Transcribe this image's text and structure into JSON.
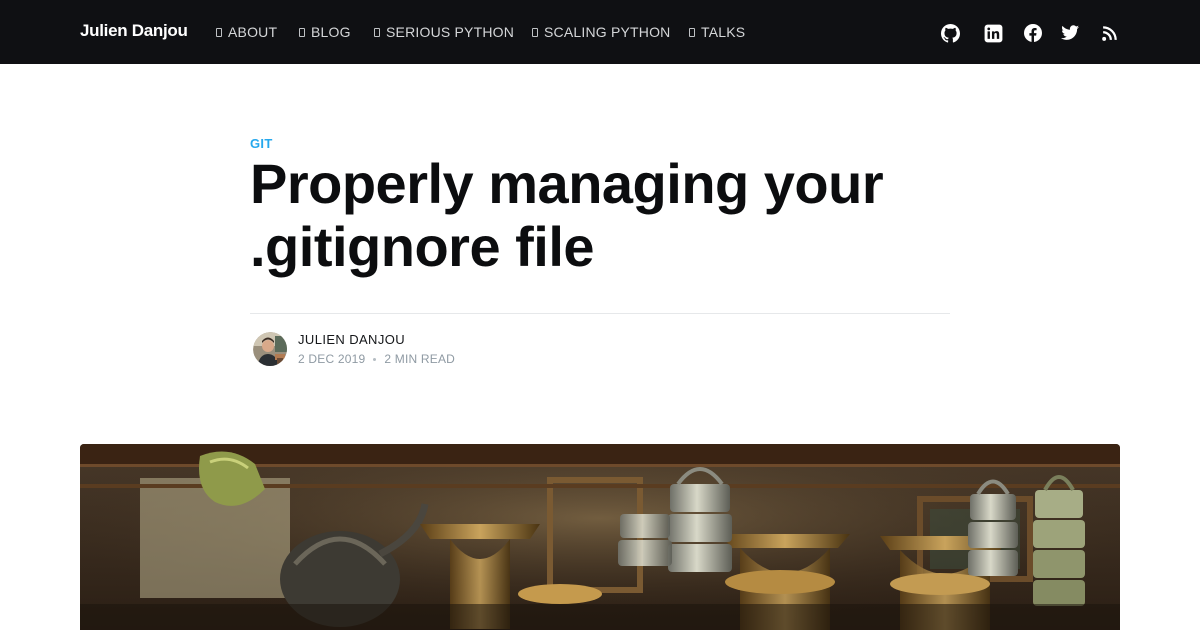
{
  "site": {
    "brand": "Julien Danjou"
  },
  "nav": {
    "items": [
      {
        "label": "ABOUT",
        "icon": "about-icon"
      },
      {
        "label": "BLOG",
        "icon": "blog-icon"
      },
      {
        "label": "SERIOUS PYTHON",
        "icon": "book-icon"
      },
      {
        "label": "SCALING PYTHON",
        "icon": "book-icon"
      },
      {
        "label": "TALKS",
        "icon": "talks-icon"
      }
    ],
    "social": [
      "github-icon",
      "linkedin-icon",
      "facebook-icon",
      "twitter-icon",
      "rss-icon"
    ]
  },
  "post": {
    "tag": "GIT",
    "title": "Properly managing your .gitignore file",
    "author": "JULIEN DANJOU",
    "date": "2 DEC 2019",
    "read_time": "2 MIN READ"
  },
  "colors": {
    "nav_bg": "#0f1013",
    "accent": "#26a8ed",
    "meta": "#8f9aa3"
  }
}
